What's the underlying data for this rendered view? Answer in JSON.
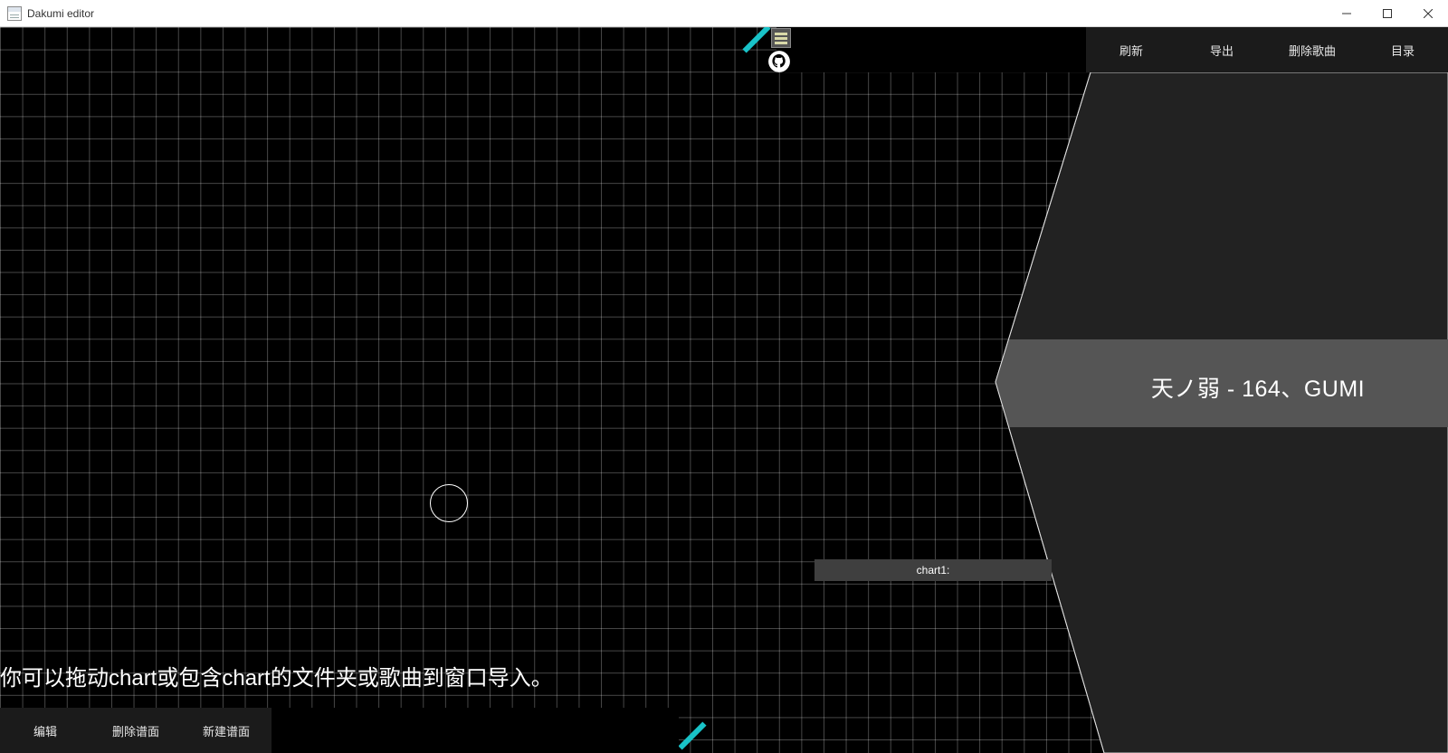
{
  "window": {
    "title": "Dakumi editor",
    "controls": [
      "minimize-icon",
      "maximize-icon",
      "close-icon"
    ]
  },
  "top_menu": {
    "items": [
      {
        "label": "刷新"
      },
      {
        "label": "导出"
      },
      {
        "label": "删除歌曲"
      },
      {
        "label": "目录"
      }
    ]
  },
  "song": {
    "title": "天ノ弱 - 164、GUMI"
  },
  "chart_list": {
    "items": [
      {
        "label": "chart1:"
      }
    ]
  },
  "hint": "你可以拖动chart或包含chart的文件夹或歌曲到窗口导入。",
  "bottom_menu": {
    "items": [
      {
        "label": "编辑"
      },
      {
        "label": "删除谱面"
      },
      {
        "label": "新建谱面"
      }
    ]
  },
  "icons": {
    "list": "list-icon",
    "github": "github-icon"
  },
  "colors": {
    "accent": "#19c3c8",
    "panel": "#222222",
    "selected_row": "#555555",
    "menu_bg": "#1b1b1b"
  }
}
